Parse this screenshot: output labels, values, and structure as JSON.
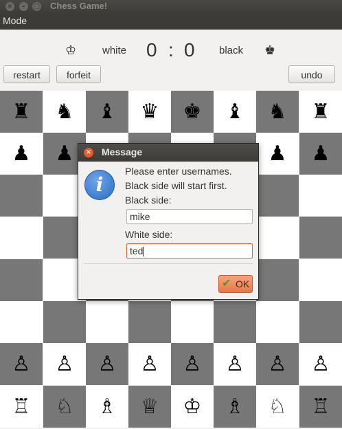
{
  "window": {
    "title": "Chess Game!"
  },
  "menu": {
    "mode_label": "Mode"
  },
  "score": {
    "white_icon": "♔",
    "white_label": "white",
    "white_score": "0",
    "separator": ":",
    "black_score": "0",
    "black_label": "black",
    "black_icon": "♚"
  },
  "toolbar": {
    "restart_label": "restart",
    "forfeit_label": "forfeit",
    "undo_label": "undo"
  },
  "board": {
    "rows": [
      [
        "♜",
        "♞",
        "♝",
        "♛",
        "♚",
        "♝",
        "♞",
        "♜"
      ],
      [
        "♟",
        "♟",
        "♟",
        "♟",
        "♟",
        "♟",
        "♟",
        "♟"
      ],
      [
        "",
        "",
        "",
        "",
        "",
        "",
        "",
        ""
      ],
      [
        "",
        "",
        "",
        "",
        "",
        "",
        "",
        ""
      ],
      [
        "",
        "",
        "",
        "",
        "",
        "",
        "",
        ""
      ],
      [
        "",
        "",
        "",
        "",
        "",
        "",
        "",
        ""
      ],
      [
        "♙",
        "♙",
        "♙",
        "♙",
        "♙",
        "♙",
        "♙",
        "♙"
      ],
      [
        "♖",
        "♘",
        "♗",
        "♕",
        "♔",
        "♗",
        "♘",
        "♖"
      ]
    ],
    "dark_color": "#777777",
    "light_color": "#ffffff"
  },
  "dialog": {
    "title": "Message",
    "icon": "information-icon",
    "line1": "Please enter usernames.",
    "line2": "Black side will start first.",
    "black_label": "Black side:",
    "black_value": "mike",
    "white_label": "White side:",
    "white_value": "ted",
    "ok_label": "OK"
  }
}
